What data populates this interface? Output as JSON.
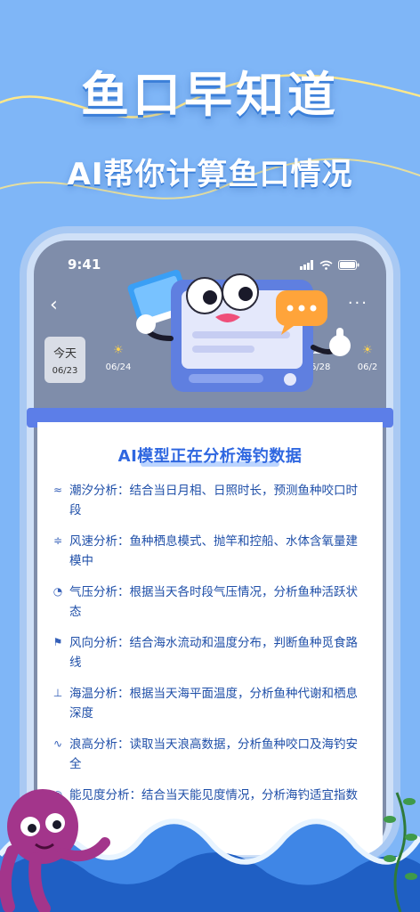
{
  "hero": {
    "title": "鱼口早知道",
    "subtitle": "AI帮你计算鱼口情况"
  },
  "phone": {
    "status_time": "9:41",
    "days": [
      {
        "label": "今天",
        "date": "06/23",
        "active": true
      },
      {
        "label": "",
        "date": "06/24",
        "active": false
      },
      {
        "label": "",
        "date": "06/28",
        "active": false
      },
      {
        "label": "",
        "date": "06/2",
        "active": false
      }
    ]
  },
  "panel": {
    "title": "AI模型正在分析海钓数据",
    "items": [
      {
        "icon": "tide-icon",
        "text": "潮汐分析：结合当日月相、日照时长，预测鱼种咬口时段"
      },
      {
        "icon": "wind-icon",
        "text": "风速分析：鱼种栖息模式、抛竿和控船、水体含氧量建模中"
      },
      {
        "icon": "pressure-icon",
        "text": "气压分析：根据当天各时段气压情况，分析鱼种活跃状态"
      },
      {
        "icon": "wind-direction-icon",
        "text": "风向分析：结合海水流动和温度分布，判断鱼种觅食路线"
      },
      {
        "icon": "thermometer-icon",
        "text": "海温分析：根据当天海平面温度，分析鱼种代谢和栖息深度"
      },
      {
        "icon": "wave-icon",
        "text": "浪高分析：读取当天浪高数据，分析鱼种咬口及海钓安全"
      },
      {
        "icon": "visibility-icon",
        "text": "能见度分析：结合当天能见度情况，分析海钓适宜指数"
      }
    ]
  },
  "colors": {
    "background": "#7fb6f7",
    "accent": "#2f67e0",
    "text_blue": "#1f4fa8"
  }
}
